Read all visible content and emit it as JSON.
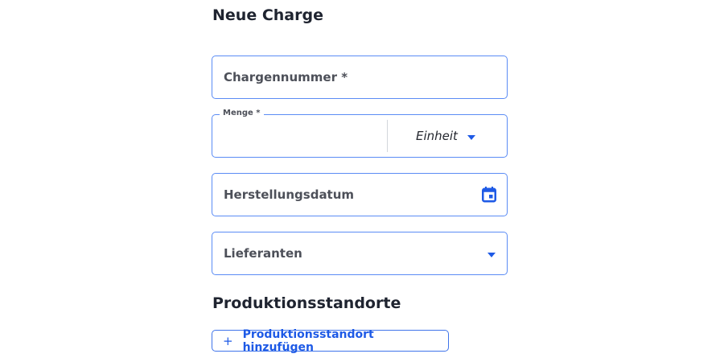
{
  "page": {
    "title": "Neue Charge"
  },
  "form": {
    "chargennummer": {
      "label": "Chargennummer *",
      "value": ""
    },
    "menge": {
      "label": "Menge *",
      "value": "",
      "unit_placeholder": "Einheit"
    },
    "herstellungsdatum": {
      "label": "Herstellungsdatum",
      "value": "",
      "icon": "calendar-icon"
    },
    "lieferanten": {
      "label": "Lieferanten",
      "value": "",
      "icon": "chevron-down-icon"
    }
  },
  "production": {
    "section_title": "Produktionsstandorte",
    "add_button": {
      "icon": "+",
      "label": "Produktionsstandort hinzufügen"
    }
  },
  "colors": {
    "accent": "#1e5ae6",
    "border": "#5b8cf5",
    "text": "#1f2430",
    "label": "#4d5059"
  }
}
